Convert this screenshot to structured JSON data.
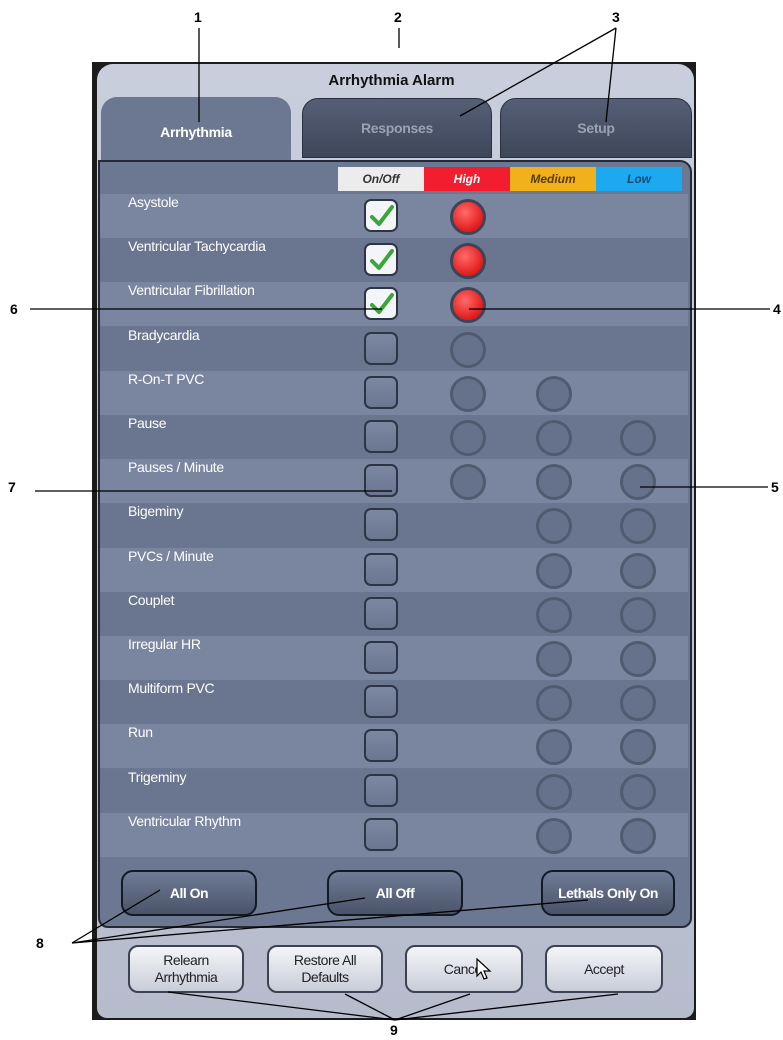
{
  "window": {
    "title": "Arrhythmia Alarm"
  },
  "tabs": [
    {
      "label": "Arrhythmia",
      "active": true
    },
    {
      "label": "Responses",
      "active": false
    },
    {
      "label": "Setup",
      "active": false
    }
  ],
  "columns": {
    "onoff": "On/Off",
    "high": "High",
    "medium": "Medium",
    "low": "Low"
  },
  "colors": {
    "high": "#f21d2f",
    "medium": "#f1b11a",
    "low": "#1ca9ef",
    "panel": "#6c7891"
  },
  "rows": [
    {
      "label": "Asystole",
      "checked": true,
      "high": "red",
      "medium": null,
      "low": null
    },
    {
      "label": "Ventricular Tachycardia",
      "checked": true,
      "high": "red",
      "medium": null,
      "low": null
    },
    {
      "label": "Ventricular Fibrillation",
      "checked": true,
      "high": "red",
      "medium": null,
      "low": null
    },
    {
      "label": "Bradycardia",
      "checked": false,
      "high": "off",
      "medium": null,
      "low": null
    },
    {
      "label": "R-On-T PVC",
      "checked": false,
      "high": "off",
      "medium": "off",
      "low": null
    },
    {
      "label": "Pause",
      "checked": false,
      "high": "off",
      "medium": "off",
      "low": "off"
    },
    {
      "label": "Pauses / Minute",
      "checked": false,
      "high": "off",
      "medium": "off",
      "low": "off"
    },
    {
      "label": "Bigeminy",
      "checked": false,
      "high": null,
      "medium": "off",
      "low": "off"
    },
    {
      "label": "PVCs / Minute",
      "checked": false,
      "high": null,
      "medium": "off",
      "low": "off"
    },
    {
      "label": "Couplet",
      "checked": false,
      "high": null,
      "medium": "off",
      "low": "off"
    },
    {
      "label": "Irregular HR",
      "checked": false,
      "high": null,
      "medium": "off",
      "low": "off"
    },
    {
      "label": "Multiform PVC",
      "checked": false,
      "high": null,
      "medium": "off",
      "low": "off"
    },
    {
      "label": "Run",
      "checked": false,
      "high": null,
      "medium": "off",
      "low": "off"
    },
    {
      "label": "Trigeminy",
      "checked": false,
      "high": null,
      "medium": "off",
      "low": "off"
    },
    {
      "label": "Ventricular Rhythm",
      "checked": false,
      "high": null,
      "medium": "off",
      "low": "off"
    }
  ],
  "buttons": {
    "all_on": "All On",
    "all_off": "All Off",
    "lethals_only_on": "Lethals Only On",
    "relearn_line1": "Relearn",
    "relearn_line2": "Arrhythmia",
    "restore_line1": "Restore All",
    "restore_line2": "Defaults",
    "cancel": "Cancel",
    "accept": "Accept"
  },
  "callouts": [
    "1",
    "2",
    "3",
    "4",
    "5",
    "6",
    "7",
    "8",
    "9"
  ]
}
